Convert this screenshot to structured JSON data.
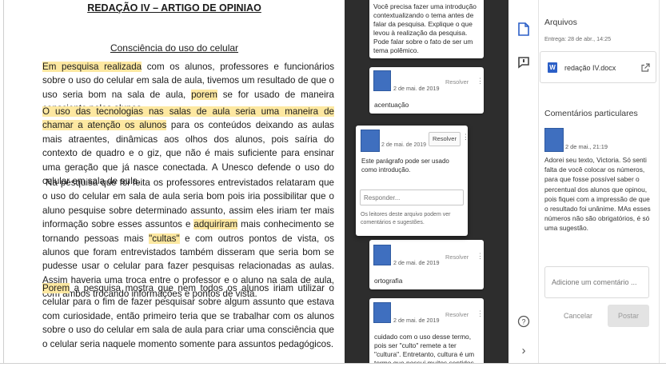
{
  "document": {
    "title": "REDAÇÃO IV – ARTIGO DE OPINIAO",
    "subtitle": "Consciência do uso do celular",
    "p1_hl1": "Em pesquisa realizada",
    "p1_a": " com os alunos, professores e funcionários sobre o uso do celular em sala de aula, tivemos um resultado de que o uso seria bom na sala de aula, ",
    "p1_hl2": "porem",
    "p1_b": " se for usado de maneira consciente pelos alunos.",
    "p2_hl": "O uso das tecnologias nas salas de aula seria uma maneira de chamar a atenção os alunos",
    "p2_rest": " para os conteúdos deixando as aulas mais atraentes, dinâmicas aos olhos dos alunos, pois saíria do contexto de quadro e o giz, que não é mais suficiente para ensinar uma geração que já nasce conectada. A Unesco defende o uso do celular em sala de aula.",
    "p3_a": "Na pesquisa  que foi feita os professores  entrevistados relataram que o uso do celular em sala de aula seria  bom pois iria  possibilitar que o aluno pesquise sobre determinado assunto,  assim  eles iriam ter mais informação sobre esses assuntos e ",
    "p3_hl1": "adquiriram",
    "p3_b": " mais conhecimento se tornando pessoas mais ",
    "p3_hl2": "\"cultas\"",
    "p3_c": " e com outros pontos de vista, os alunos que foram entrevistados também disseram que seria bom se pudesse usar o celular para fazer pesquisas relacionadas as aulas. Assim haveria uma troca entre o professor e o aluno na sala de aula, com ambos trocando informações e pontos de vista.",
    "p4_hl": "Porem",
    "p4_rest": " a pesquisa mostra que nem todos os alunos iriam utilizar o celular para o fim de fazer pesquisar sobre algum assunto que estava com curiosidade, então primeiro teria que se trabalhar com os alunos sobre o uso do celular em sala de aula para criar uma consciência que o celular seria naquele momento somente para assuntos pedagógicos."
  },
  "comments": {
    "c0_text": "Você precisa fazer uma introdução contextualizando o tema antes de falar da pesquisa. Explique o que levou à realização da pesquisa. Pode falar sobre o fato de ser um tema polêmico.",
    "c1_date": "2 de mai. de 2019",
    "c1_resolve": "Resolver",
    "c1_text": "acentuação",
    "active_date": "2 de mai. de 2019",
    "active_resolve": "Resolver",
    "active_text": "Este parágrafo pode ser usado como introdução.",
    "reply_placeholder": "Responder...",
    "active_note": "Os leitores deste arquivo podem ver comentários e sugestões.",
    "c3_date": "2 de mai. de 2019",
    "c3_resolve": "Resolver",
    "c3_text": "ortografia",
    "c4_date": "2 de mai. de 2019",
    "c4_resolve": "Resolver",
    "c4_text": "cuidado com o uso desse termo, pois ser \"culto\" remete a ter \"cultura\". Entretanto, cultura é um termo que possui muitos sentidos. Segundo o"
  },
  "sidebar": {
    "files_heading": "Arquivos",
    "delivery": "Entrega: 28 de abr., 14:25",
    "file_name": "redação IV.docx",
    "private_heading": "Comentários particulares",
    "private_date": "2 de mai., 21:19",
    "private_text": "Adorei seu texto, Victoria. Só senti falta de você colocar os números, para que fosse possível saber o percentual dos alunos que opinou, pois fiquei com a impressão de que o resultado foi unânime. MAs esses números não são obrigatórios, é só uma sugestão.",
    "add_placeholder": "Adicione um comentário ...",
    "cancel_label": "Cancelar",
    "post_label": "Postar",
    "help_glyph": "?",
    "expand_glyph": "›"
  },
  "colors": {
    "highlight": "#fde8a1",
    "gutter": "#2d2d2d",
    "avatar": "#3f6fbf",
    "file_icon": "#2b5fc7"
  },
  "icons": [
    "file-icon",
    "comment-icon",
    "word-file-icon",
    "open-external-icon",
    "help-icon",
    "expand-icon",
    "more-options-icon"
  ]
}
